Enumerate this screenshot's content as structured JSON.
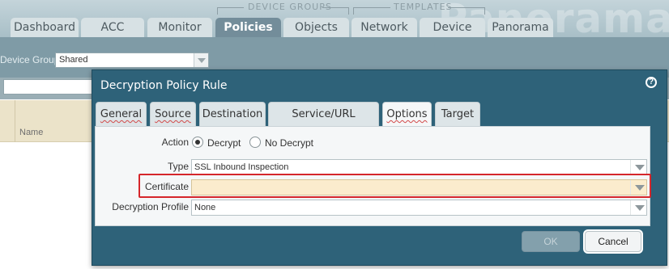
{
  "header": {
    "brand_watermark": "Panorama",
    "group_labels": {
      "device_groups": "DEVICE GROUPS",
      "templates": "TEMPLATES"
    },
    "tabs": [
      {
        "label": "Dashboard"
      },
      {
        "label": "ACC"
      },
      {
        "label": "Monitor"
      },
      {
        "label": "Policies",
        "active": true
      },
      {
        "label": "Objects"
      },
      {
        "label": "Network"
      },
      {
        "label": "Device"
      },
      {
        "label": "Panorama"
      }
    ]
  },
  "device_group": {
    "label": "Device Group",
    "value": "Shared"
  },
  "table": {
    "name_header": "Name"
  },
  "dialog": {
    "title": "Decryption Policy Rule",
    "help_icon": "?",
    "tabs": [
      {
        "label": "General"
      },
      {
        "label": "Source"
      },
      {
        "label": "Destination"
      },
      {
        "label": "Service/URL Category"
      },
      {
        "label": "Options",
        "active": true
      },
      {
        "label": "Target"
      }
    ],
    "fields": {
      "action": {
        "label": "Action",
        "options": [
          "Decrypt",
          "No Decrypt"
        ],
        "selected": "Decrypt"
      },
      "type": {
        "label": "Type",
        "value": "SSL Inbound Inspection"
      },
      "certificate": {
        "label": "Certificate",
        "value": ""
      },
      "decryption_profile": {
        "label": "Decryption Profile",
        "value": "None"
      }
    },
    "buttons": {
      "ok": "OK",
      "cancel": "Cancel"
    }
  },
  "colors": {
    "dialog_bg": "#2e6279",
    "active_tab": "#738d9a",
    "highlight": "#d5262b",
    "certificate_field_bg": "#fbeccd"
  }
}
